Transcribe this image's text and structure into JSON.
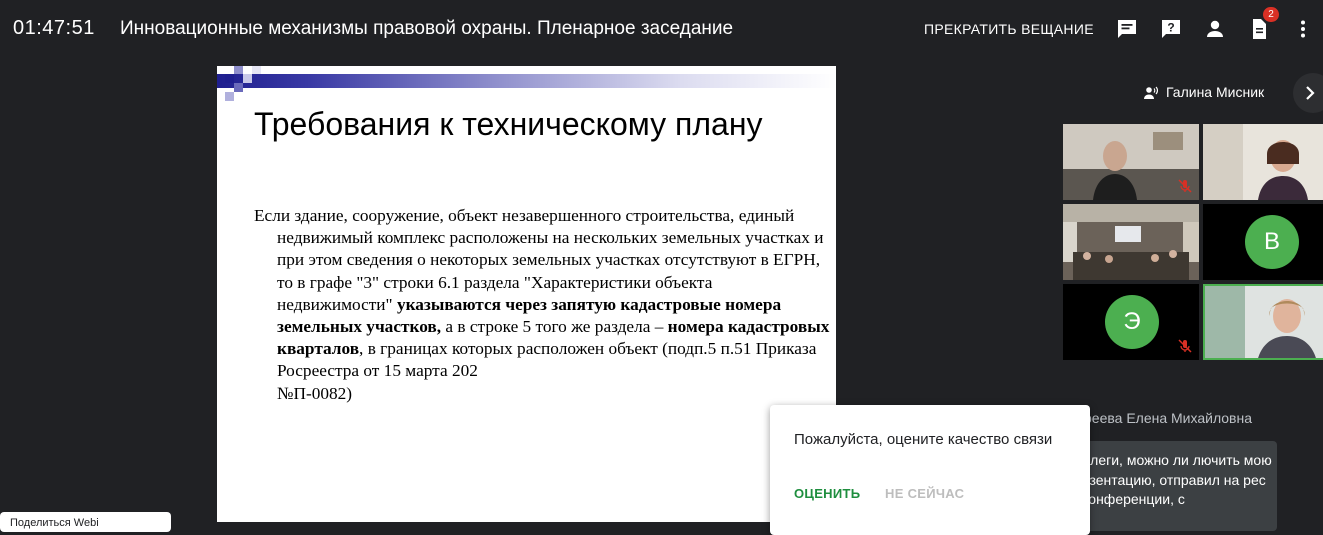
{
  "header": {
    "timer": "01:47:51",
    "title": "Инновационные механизмы правовой охраны. Пленарное заседание",
    "stop_broadcast": "ПРЕКРАТИТЬ ВЕЩАНИЕ",
    "notification_count": "2"
  },
  "slide": {
    "title": "Требования к техническому плану",
    "body_1": "Если здание, сооружение, объект незавершенного строительства, единый недвижимый комплекс расположены на нескольких земельных участках и при этом сведения о некоторых земельных участках отсутствуют в ЕГРН, то в графе \"3\" строки 6.1 раздела \"Характеристики объекта недвижимости\" ",
    "body_bold_1": "указываются через запятую кадастровые номера земельных участков,",
    "body_2": " а в строке 5 того же раздела – ",
    "body_bold_2": "номера кадастровых кварталов",
    "body_3": ", в границах которых расположен объект (подп.5 п.51 Приказа Росреестра от 15 марта 202",
    "body_4": "№П-0082)"
  },
  "speaker": {
    "name": "Галина Мисник"
  },
  "participants": [
    {
      "type": "video",
      "muted": true
    },
    {
      "type": "video",
      "muted": true
    },
    {
      "type": "video",
      "muted": false
    },
    {
      "type": "avatar",
      "initial": "В",
      "muted": true,
      "color": "#4caf50"
    },
    {
      "type": "avatar",
      "initial": "Э",
      "muted": true,
      "color": "#4caf50"
    },
    {
      "type": "video",
      "muted": false,
      "active": true
    }
  ],
  "chat": {
    "sender": "реева Елена Михайловна",
    "message": "ллеги, можно ли лючить мою езентацию, отправил на рес конференции, с"
  },
  "rating_popup": {
    "question": "Пожалуйста, оцените качество связи",
    "rate": "ОЦЕНИТЬ",
    "later": "НЕ СЕЙЧАС"
  },
  "bottom_pill": {
    "label": "Поделиться Webi"
  },
  "colors": {
    "background": "#202124",
    "accent_green": "#1e8e3e",
    "badge_red": "#d93025",
    "avatar_green": "#4caf50"
  }
}
